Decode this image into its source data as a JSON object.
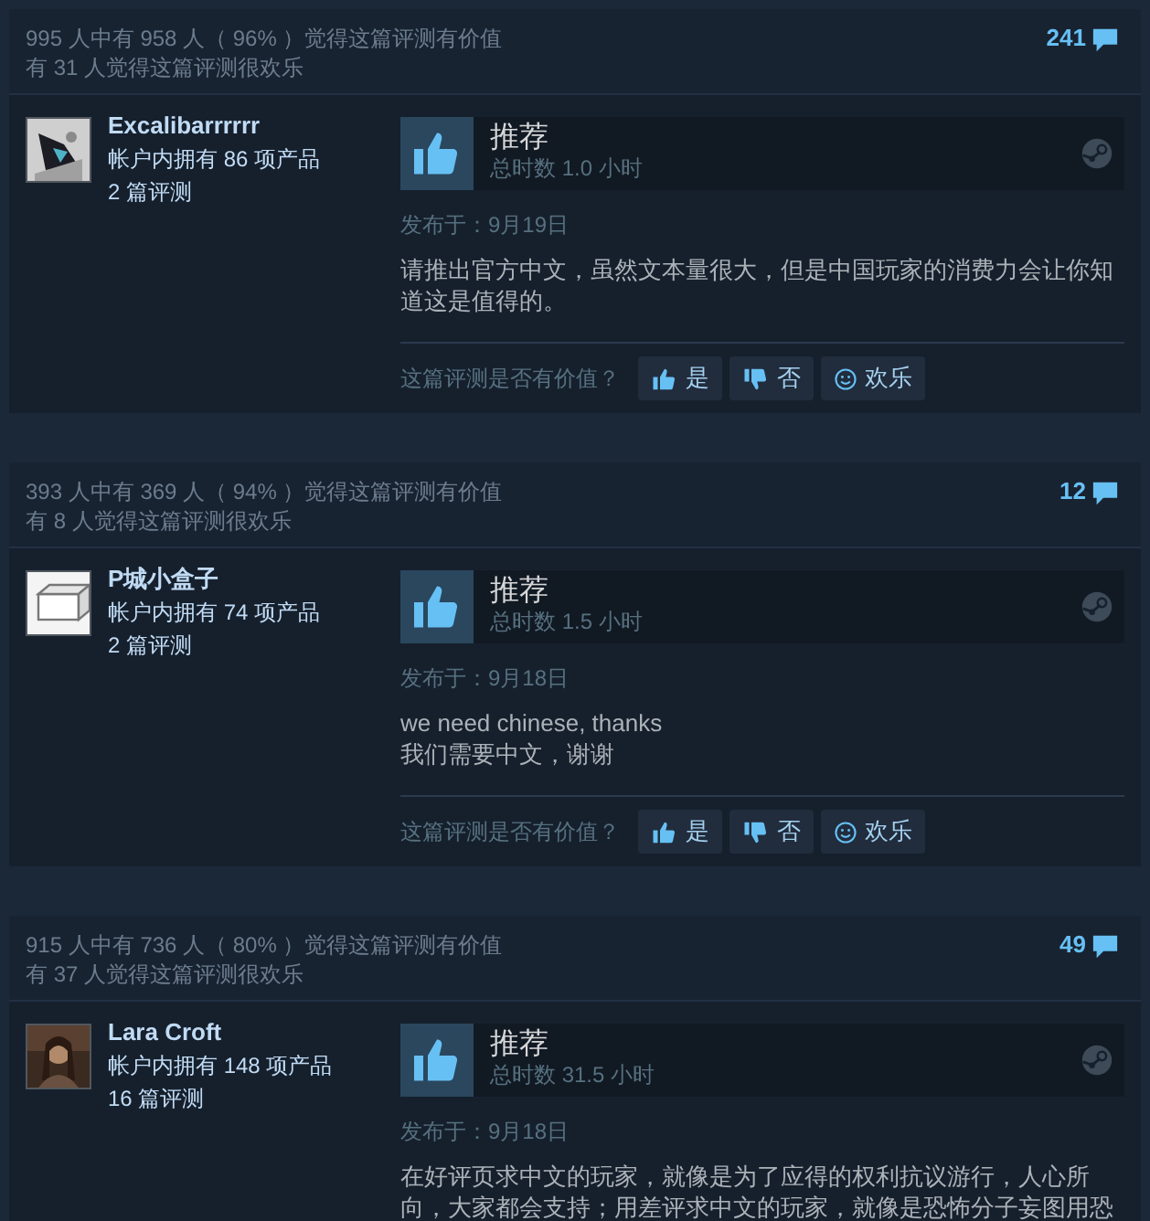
{
  "reviews": [
    {
      "helpful": "995 人中有 958 人（ 96% ）觉得这篇评测有价值",
      "funny": "有 31 人觉得这篇评测很欢乐",
      "comments": "241",
      "author": {
        "name": "Excalibarrrrrr",
        "products": "帐户内拥有 86 项产品",
        "reviews": "2 篇评测"
      },
      "verdict": "推荐",
      "recommended": true,
      "hours": "总时数 1.0 小时",
      "posted": "发布于：9月19日",
      "body": [
        "请推出官方中文，虽然文本量很大，但是中国玩家的消费力会让你知道这是值得的。"
      ],
      "vote_prompt": "这篇评测是否有价值？",
      "buttons": [
        {
          "label": "是",
          "kind": "up"
        },
        {
          "label": "否",
          "kind": "down"
        },
        {
          "label": "欢乐",
          "kind": "funny"
        }
      ]
    },
    {
      "helpful": "393 人中有 369 人（ 94% ）觉得这篇评测有价值",
      "funny": "有 8 人觉得这篇评测很欢乐",
      "comments": "12",
      "author": {
        "name": "P城小盒子",
        "products": "帐户内拥有 74 项产品",
        "reviews": "2 篇评测"
      },
      "verdict": "推荐",
      "recommended": true,
      "hours": "总时数 1.5 小时",
      "posted": "发布于：9月18日",
      "body": [
        "we need chinese, thanks",
        "我们需要中文，谢谢"
      ],
      "vote_prompt": "这篇评测是否有价值？",
      "buttons": [
        {
          "label": "是",
          "kind": "up"
        },
        {
          "label": "否",
          "kind": "down"
        },
        {
          "label": "欢乐",
          "kind": "funny"
        }
      ]
    },
    {
      "helpful": "915 人中有 736 人（ 80% ）觉得这篇评测有价值",
      "funny": "有 37 人觉得这篇评测很欢乐",
      "comments": "49",
      "author": {
        "name": "Lara Croft",
        "products": "帐户内拥有 148 项产品",
        "reviews": "16 篇评测"
      },
      "verdict": "推荐",
      "recommended": true,
      "hours": "总时数 31.5 小时",
      "posted": "发布于：9月18日",
      "body": [
        "在好评页求中文的玩家，就像是为了应得的权利抗议游行，人心所向，大家都会支持；用差评求中文的玩家，就像是恐怖分子妄图用恐"
      ]
    }
  ]
}
